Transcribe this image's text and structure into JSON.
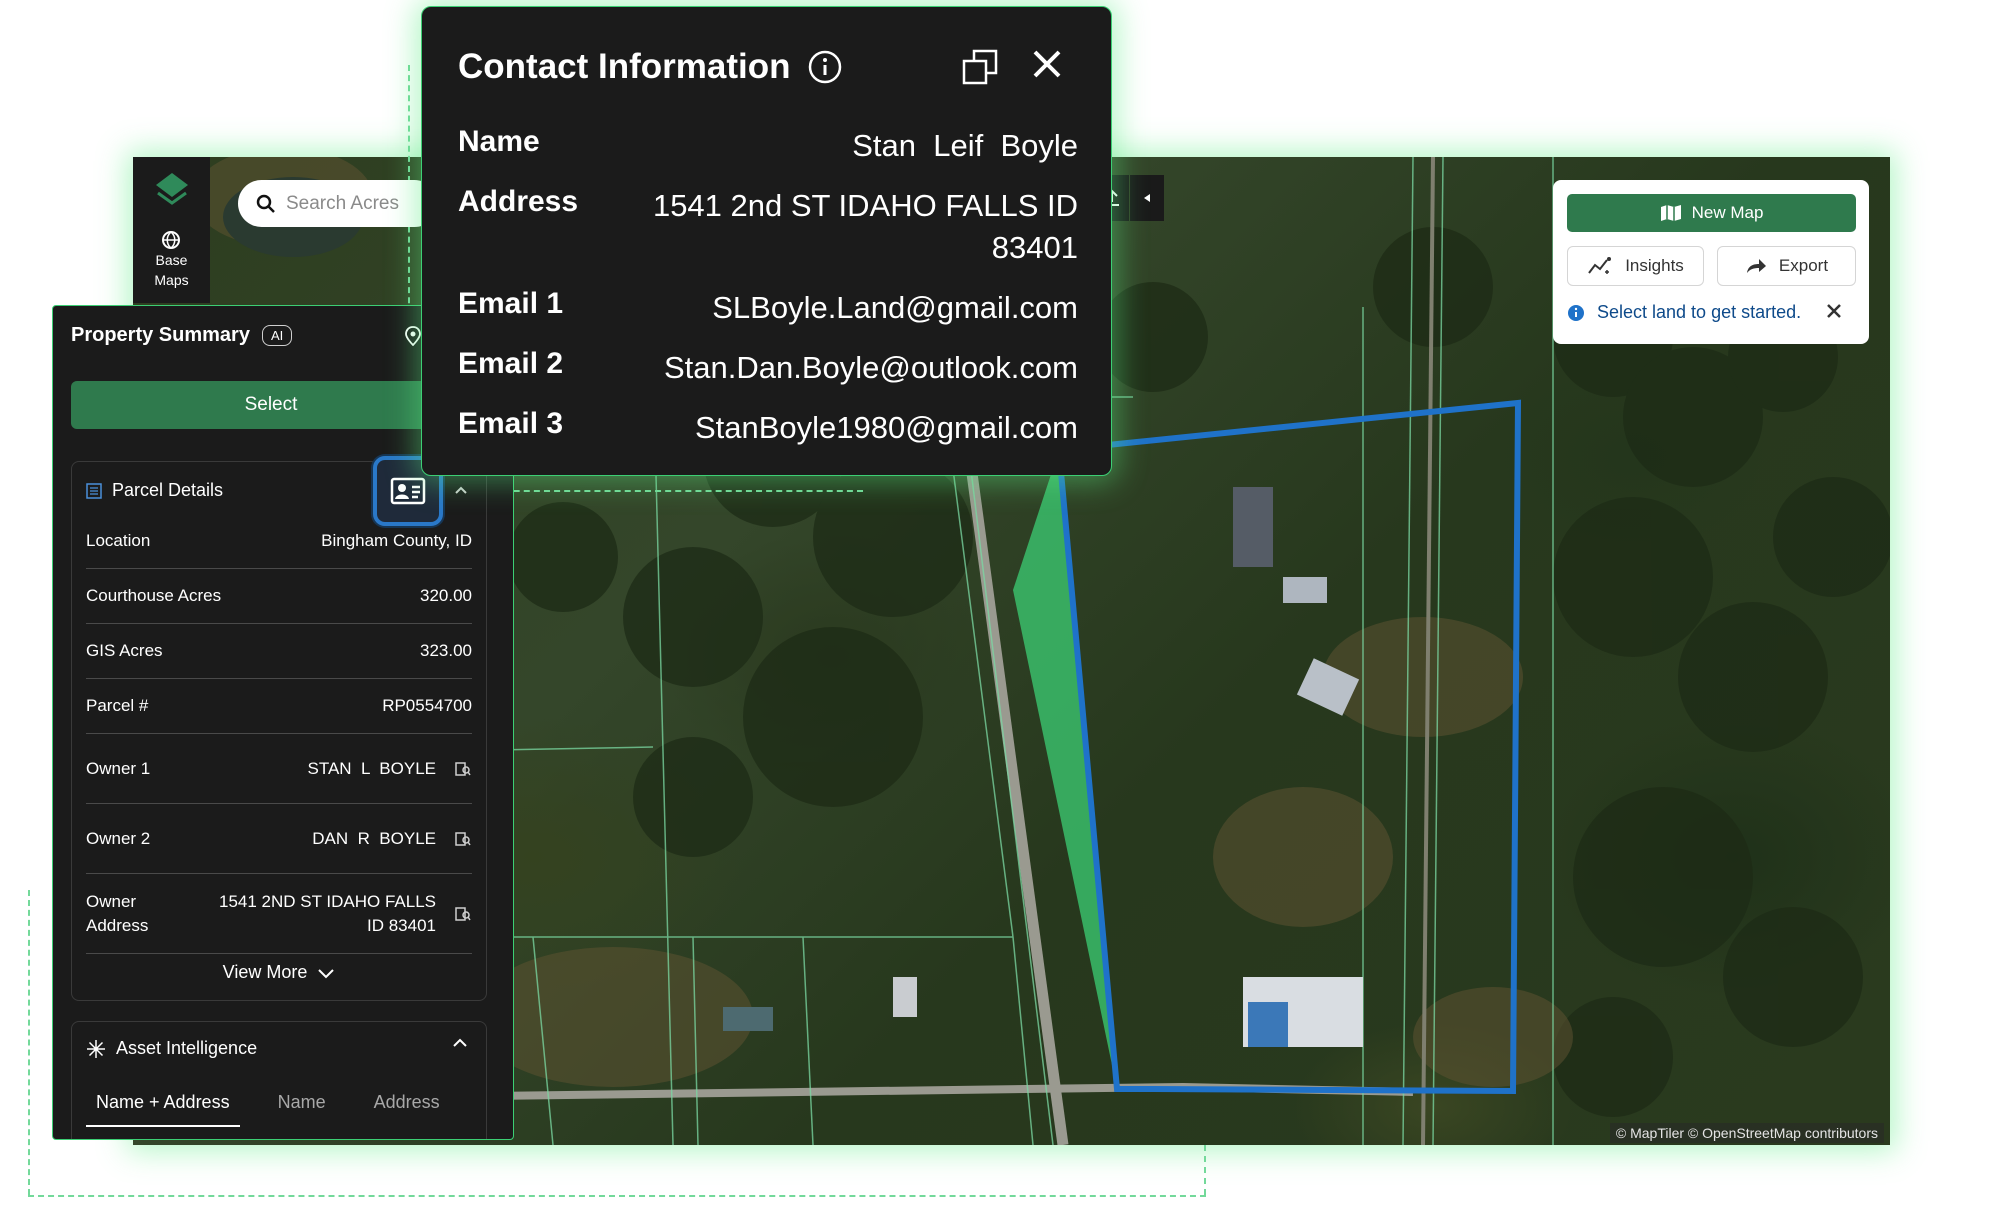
{
  "search": {
    "placeholder": "Search Acres"
  },
  "rail": {
    "base_maps_label_line1": "Base",
    "base_maps_label_line2": "Maps"
  },
  "property_summary": {
    "title": "Property Summary",
    "ai_badge": "AI",
    "select_label": "Select",
    "parcel_details": {
      "title": "Parcel Details",
      "rows": [
        {
          "label": "Location",
          "value": "Bingham County, ID"
        },
        {
          "label": "Courthouse Acres",
          "value": "320.00"
        },
        {
          "label": "GIS Acres",
          "value": "323.00"
        },
        {
          "label": "Parcel #",
          "value": "RP0554700"
        },
        {
          "label": "Owner 1",
          "value": "STAN  L  BOYLE"
        },
        {
          "label": "Owner 2",
          "value": "DAN  R  BOYLE"
        },
        {
          "label_line1": "Owner",
          "label_line2": "Address",
          "value_line1": "1541 2ND ST IDAHO FALLS",
          "value_line2": "ID 83401"
        }
      ],
      "view_more": "View More"
    },
    "asset_intelligence": {
      "title": "Asset Intelligence",
      "tabs": [
        "Name + Address",
        "Name",
        "Address"
      ],
      "active_tab": "Name + Address"
    }
  },
  "contact_info": {
    "title": "Contact Information",
    "rows": [
      {
        "label": "Name",
        "value": "Stan  Leif  Boyle"
      },
      {
        "label": "Address",
        "value_line1": "1541 2nd ST IDAHO FALLS ID",
        "value_line2": "83401"
      },
      {
        "label": "Email 1",
        "value": "SLBoyle.Land@gmail.com"
      },
      {
        "label": "Email 2",
        "value": "Stan.Dan.Boyle@outlook.com"
      },
      {
        "label": "Email 3",
        "value": "StanBoyle1980@gmail.com"
      }
    ]
  },
  "widget": {
    "new_map": "New Map",
    "insights": "Insights",
    "export": "Export",
    "message": "Select land to get started."
  },
  "map": {
    "attribution": "© MapTiler © OpenStreetMap contributors"
  },
  "colors": {
    "accent_green": "#2f7a4d",
    "highlight_green": "#3ccf74",
    "selection_blue": "#1f72c9",
    "panel_bg": "#1b1b1b"
  },
  "icons": [
    "layers-icon",
    "globe-icon",
    "search-icon",
    "pin-icon",
    "list-icon",
    "contact-card-icon",
    "lookup-icon",
    "chevron-down-icon",
    "chevron-up-icon",
    "sparkle-icon",
    "info-icon",
    "copy-icon",
    "close-icon",
    "map-icon",
    "insights-icon",
    "export-icon",
    "upload-icon",
    "caret-left-icon"
  ]
}
